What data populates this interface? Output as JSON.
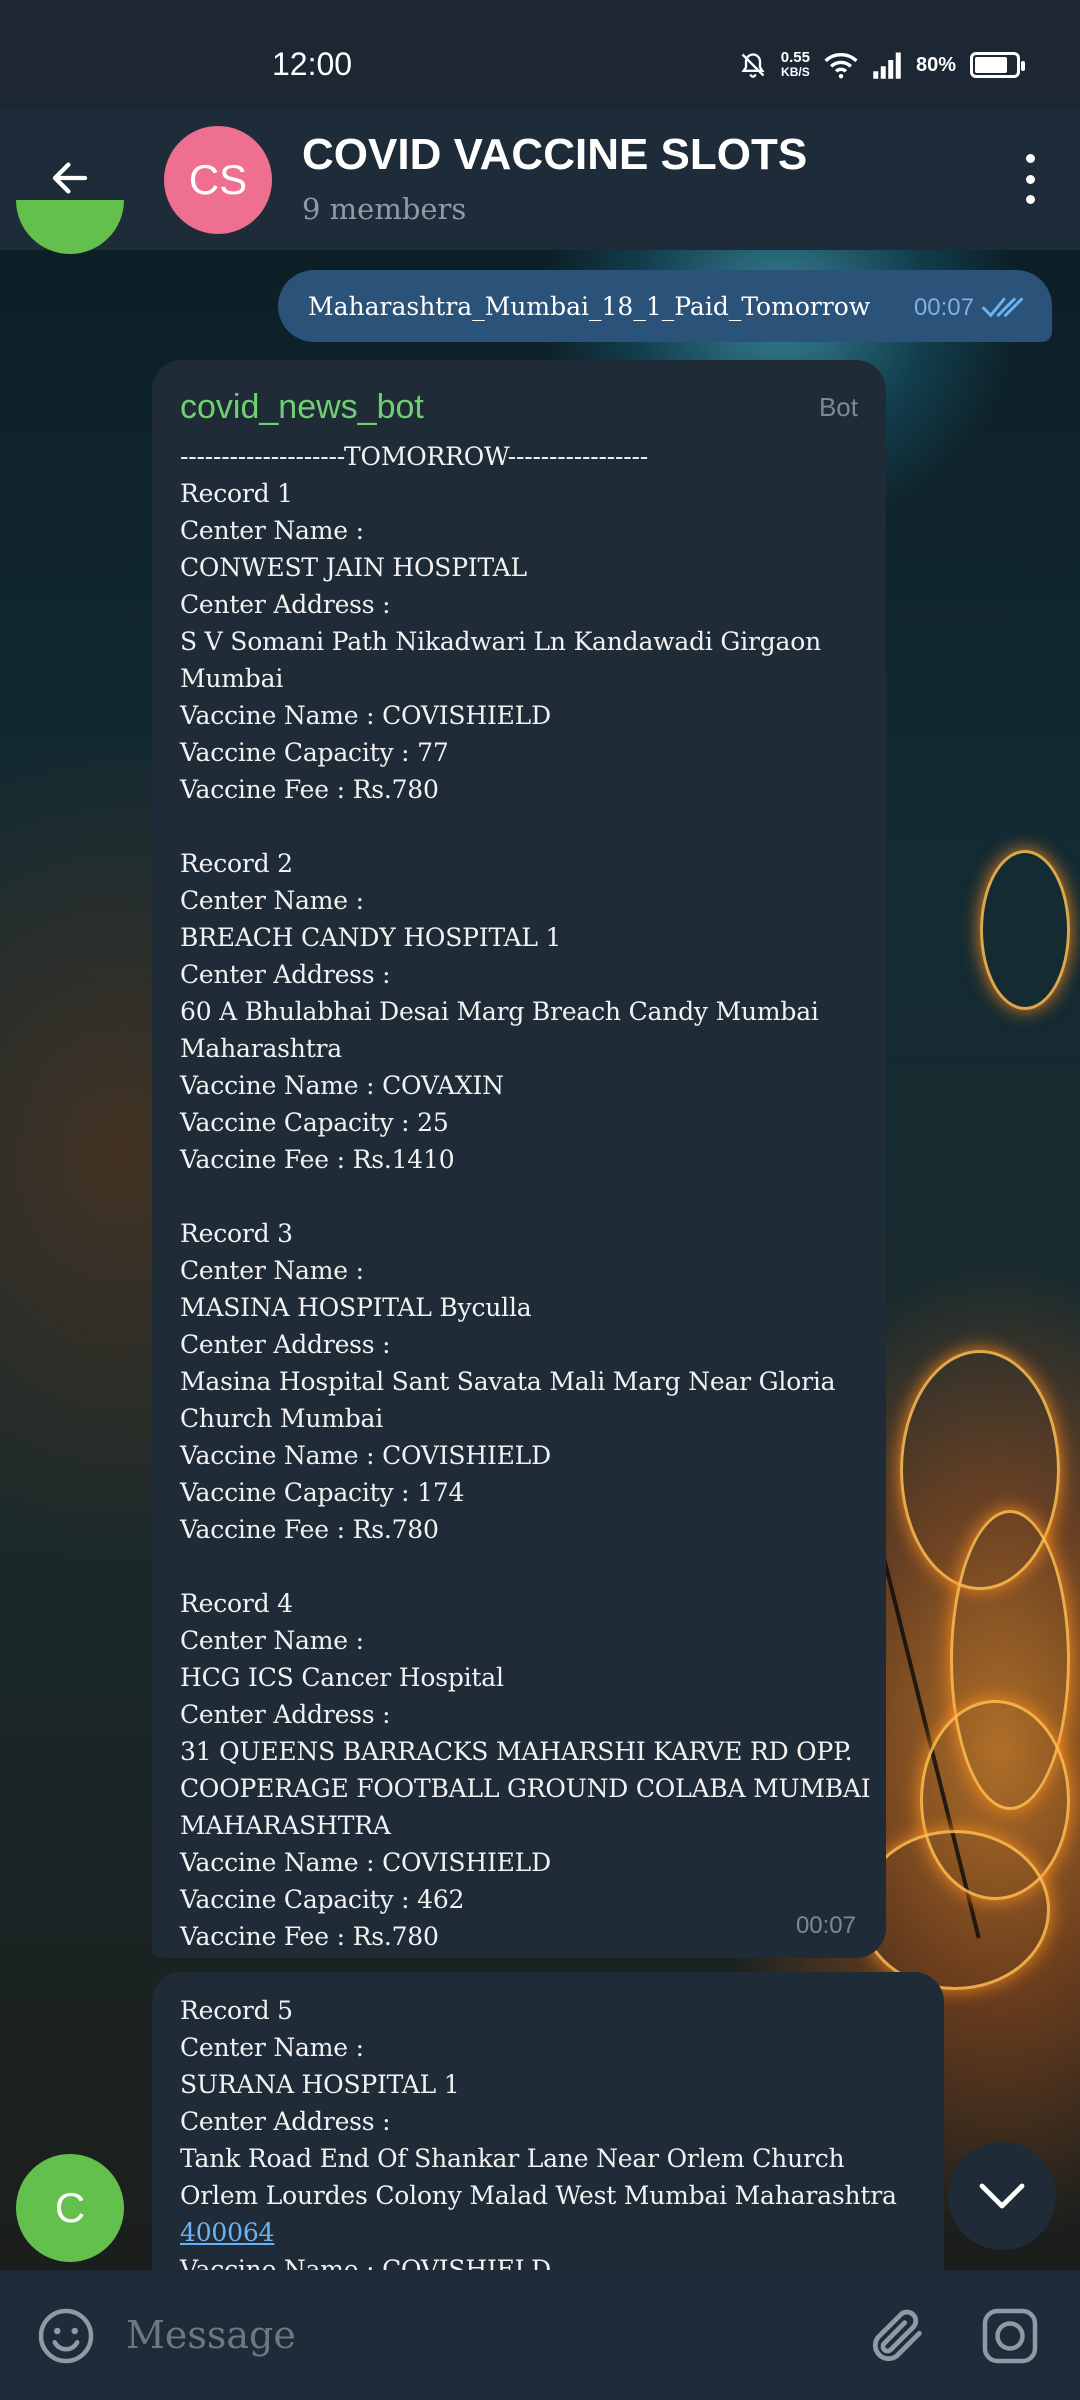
{
  "status_bar": {
    "time": "12:00",
    "net_speed_value": "0.55",
    "net_speed_unit": "KB/S",
    "battery": "80%",
    "battery_level": 0.8,
    "icons": [
      "mute-bell-icon",
      "wifi-icon",
      "signal-icon",
      "battery-icon"
    ]
  },
  "header": {
    "avatar_initials": "CS",
    "avatar_color": "#ee6f8f",
    "title": "COVID VACCINE SLOTS",
    "subtitle": "9 members"
  },
  "outgoing": {
    "text": "Maharashtra_Mumbai_18_1_Paid_Tomorrow",
    "time": "00:07",
    "status": "read"
  },
  "bot_message": {
    "sender": "covid_news_bot",
    "tag": "Bot",
    "time": "00:07",
    "lines": [
      "--------------------TOMORROW-----------------",
      "Record 1",
      "Center Name :",
      "CONWEST JAIN HOSPITAL",
      "Center Address :",
      "S V Somani Path Nikadwari Ln Kandawadi Girgaon",
      "Mumbai",
      "Vaccine Name : COVISHIELD",
      "Vaccine Capacity : 77",
      "Vaccine Fee : Rs.780",
      "",
      "Record 2",
      "Center Name :",
      "BREACH CANDY HOSPITAL 1",
      "Center Address :",
      "60 A Bhulabhai Desai Marg Breach Candy Mumbai",
      "Maharashtra",
      "Vaccine Name : COVAXIN",
      "Vaccine Capacity : 25",
      "Vaccine Fee : Rs.1410",
      "",
      "Record 3",
      "Center Name :",
      "MASINA HOSPITAL Byculla",
      "Center Address :",
      "Masina Hospital Sant Savata Mali Marg Near Gloria",
      "Church Mumbai",
      "Vaccine Name : COVISHIELD",
      "Vaccine Capacity : 174",
      "Vaccine Fee : Rs.780",
      "",
      "Record 4",
      "Center Name :",
      "HCG ICS Cancer Hospital",
      "Center Address :",
      "31 QUEENS BARRACKS MAHARSHI KARVE RD OPP.",
      "COOPERAGE FOOTBALL GROUND COLABA MUMBAI",
      "MAHARASHTRA",
      "Vaccine Name : COVISHIELD",
      "Vaccine Capacity : 462",
      "Vaccine Fee : Rs.780"
    ]
  },
  "bot_message_2": {
    "lines": [
      "Record 5",
      "Center Name :",
      "SURANA HOSPITAL 1",
      "Center Address :",
      "Tank Road End Of Shankar Lane Near Orlem Church",
      "Orlem Lourdes Colony Malad West Mumbai Maharashtra"
    ],
    "link": "400064",
    "partial_line": "Vaccine Name : COVISHIELD"
  },
  "sender_avatar": {
    "initial": "C",
    "color": "#64c04c"
  },
  "input": {
    "placeholder": "Message",
    "icons": [
      "emoji-icon",
      "attach-icon",
      "camera-icon"
    ]
  }
}
